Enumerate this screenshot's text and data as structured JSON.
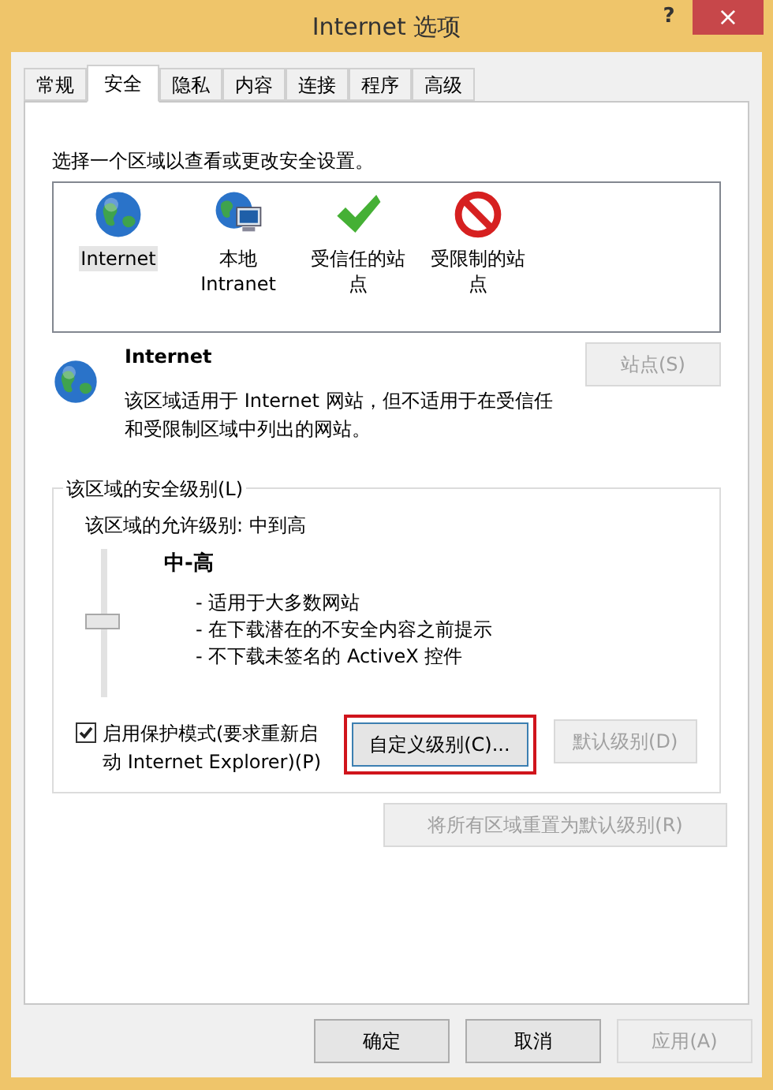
{
  "window": {
    "title": "Internet 选项",
    "help": "?",
    "close": "×"
  },
  "tabs": [
    {
      "label": "常规",
      "selected": false
    },
    {
      "label": "安全",
      "selected": true
    },
    {
      "label": "隐私",
      "selected": false
    },
    {
      "label": "内容",
      "selected": false
    },
    {
      "label": "连接",
      "selected": false
    },
    {
      "label": "程序",
      "selected": false
    },
    {
      "label": "高级",
      "selected": false
    }
  ],
  "zone_prompt": "选择一个区域以查看或更改安全设置。",
  "zones": [
    {
      "kind": "globe",
      "label": "Internet",
      "selected": true
    },
    {
      "kind": "intranet",
      "label": "本地 Intranet",
      "selected": false
    },
    {
      "kind": "trusted",
      "label": "受信任的站点",
      "selected": false
    },
    {
      "kind": "restricted",
      "label": "受限制的站点",
      "selected": false
    }
  ],
  "zone_info": {
    "kind": "globe",
    "title": "Internet",
    "description": "该区域适用于 Internet 网站，但不适用于在受信任和受限制区域中列出的网站。",
    "sites_button": {
      "label": "站点(S)",
      "disabled": true
    }
  },
  "security_level": {
    "group_label": "该区域的安全级别(L)",
    "allowed": "该区域的允许级别: 中到高",
    "level": 0.5,
    "level_name": "中-高",
    "bullets": [
      "- 适用于大多数网站",
      "- 在下载潜在的不安全内容之前提示",
      "- 不下载未签名的 ActiveX 控件"
    ],
    "protected_mode": {
      "label": "启用保护模式(要求重新启动 Internet Explorer)(P)",
      "checked": true
    },
    "custom_button": {
      "label": "自定义级别(C)...",
      "disabled": false,
      "highlighted": true
    },
    "default_button": {
      "label": "默认级别(D)",
      "disabled": true
    }
  },
  "reset_button": {
    "label": "将所有区域重置为默认级别(R)",
    "disabled": true
  },
  "footer_buttons": [
    {
      "label": "确定",
      "disabled": false
    },
    {
      "label": "取消",
      "disabled": false
    },
    {
      "label": "应用(A)",
      "disabled": true
    }
  ]
}
